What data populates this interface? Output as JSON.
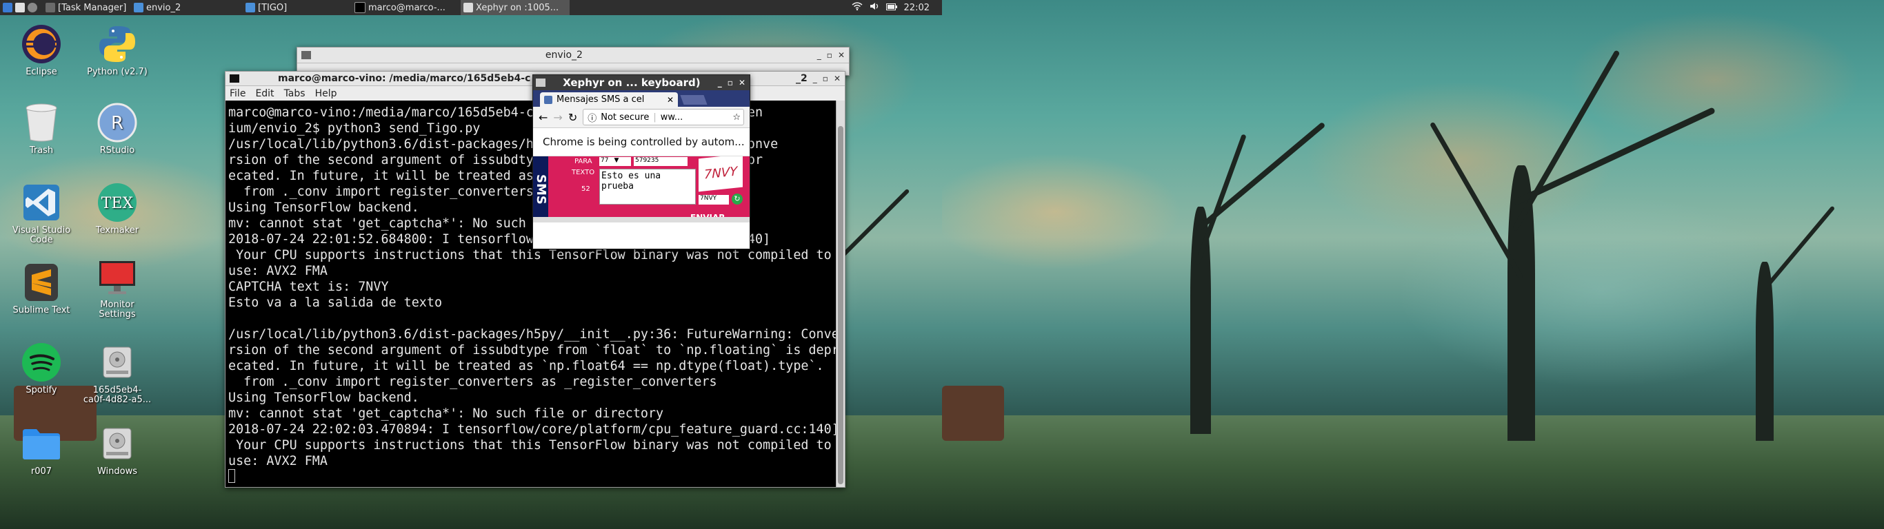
{
  "taskbar": {
    "items": [
      {
        "label": "[Task Manager]"
      },
      {
        "label": "envio_2"
      },
      {
        "label": "[TIGO]"
      },
      {
        "label": "marco@marco-..."
      },
      {
        "label": "Xephyr on :1005..."
      }
    ],
    "clock": "22:02"
  },
  "desktop_icons": [
    {
      "label": "Eclipse",
      "icon": "eclipse-icon"
    },
    {
      "label": "Python (v2.7)",
      "icon": "python-icon"
    },
    {
      "label": "Trash",
      "icon": "trash-icon"
    },
    {
      "label": "RStudio",
      "icon": "rstudio-icon"
    },
    {
      "label": "Visual Studio Code",
      "icon": "vscode-icon"
    },
    {
      "label": "Texmaker",
      "icon": "texmaker-icon"
    },
    {
      "label": "Sublime Text",
      "icon": "sublime-icon"
    },
    {
      "label": "Monitor Settings",
      "icon": "monitor-icon"
    },
    {
      "label": "Spotify",
      "icon": "spotify-icon"
    },
    {
      "label": "165d5eb4-ca0f-4d82-a5...",
      "icon": "drive-icon"
    },
    {
      "label": "r007",
      "icon": "folder-icon"
    },
    {
      "label": "Windows",
      "icon": "drive-icon"
    }
  ],
  "back_window": {
    "title": "envio_2"
  },
  "terminal": {
    "title": "marco@marco-vino: /media/marco/165d5eb4-c",
    "title_right": "_2",
    "menu": [
      "File",
      "Edit",
      "Tabs",
      "Help"
    ],
    "lines": [
      "marco@marco-vino:/media/marco/165d5eb4-c                  logCCD/Selen",
      "ium/envio_2$ python3 send_Tigo.py",
      "/usr/local/lib/python3.6/dist-packages/h                  Warning: Conve",
      "rsion of the second argument of issubdty                  ing` is depr",
      "ecated. In future, it will be treated as                  ).type`.",
      "  from ._conv import register_converters",
      "Using TensorFlow backend.",
      "mv: cannot stat 'get_captcha*': No such",
      "2018-07-24 22:01:52.684800: I tensorflow                  guard.cc:140]",
      " Your CPU supports instructions that this TensorFlow binary was not compiled to",
      "use: AVX2 FMA",
      "CAPTCHA text is: 7NVY",
      "Esto va a la salida de texto",
      "",
      "/usr/local/lib/python3.6/dist-packages/h5py/__init__.py:36: FutureWarning: Conve",
      "rsion of the second argument of issubdtype from `float` to `np.floating` is depr",
      "ecated. In future, it will be treated as `np.float64 == np.dtype(float).type`.",
      "  from ._conv import register_converters as _register_converters",
      "Using TensorFlow backend.",
      "mv: cannot stat 'get_captcha*': No such file or directory",
      "2018-07-24 22:02:03.470894: I tensorflow/core/platform/cpu_feature_guard.cc:140]",
      " Your CPU supports instructions that this TensorFlow binary was not compiled to",
      "use: AVX2 FMA"
    ]
  },
  "xephyr": {
    "title": "Xephyr on ... keyboard)",
    "tab_label": "Mensajes SMS a cel",
    "security_label": "Not secure",
    "url": "ww...",
    "infobar": "Chrome is being controlled by autom...",
    "form": {
      "para_label": "PARA",
      "texto_label": "TEXTO",
      "prefix": "77",
      "number": "579235",
      "message": "Esto es una prueba",
      "captcha": "7NVY",
      "captcha_input": "7NVY",
      "count": "52",
      "send_label": "ENVIAR"
    }
  }
}
